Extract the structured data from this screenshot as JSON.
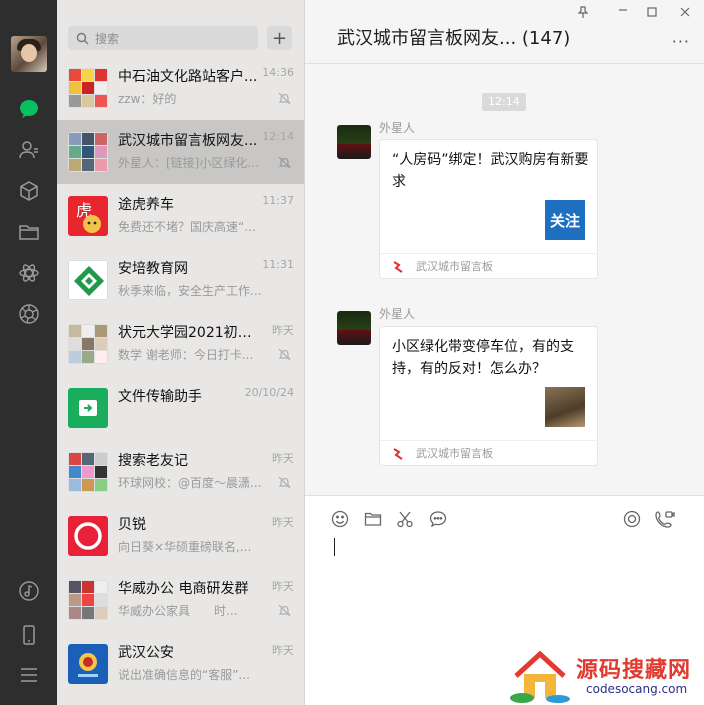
{
  "window": {
    "pin_icon": "pin-icon",
    "minimize_icon": "minimize-icon",
    "maximize_icon": "maximize-icon",
    "close_icon": "close-icon"
  },
  "sidebar": {
    "items": [
      {
        "name": "chat-icon",
        "active": true
      },
      {
        "name": "contacts-icon"
      },
      {
        "name": "collections-icon"
      },
      {
        "name": "files-icon"
      },
      {
        "name": "mini-programs-icon"
      },
      {
        "name": "moments-icon"
      },
      {
        "name": "music-icon"
      },
      {
        "name": "phone-icon"
      },
      {
        "name": "menu-icon"
      }
    ],
    "accent": "#07c160"
  },
  "search": {
    "placeholder": "搜索"
  },
  "chats": [
    {
      "name": "中石油文化路站客户...",
      "time": "14:36",
      "preview": "zzw：好的",
      "muted": true
    },
    {
      "name": "武汉城市留言板网友...",
      "time": "12:14",
      "preview": "外星人：[链接]小区绿化...",
      "muted": true,
      "active": true
    },
    {
      "name": "途虎养车",
      "time": "11:37",
      "preview": "免费还不堵？国庆高速“...",
      "muted": false
    },
    {
      "name": "安培教育网",
      "time": "11:31",
      "preview": "秋季来临，安全生产工作...",
      "muted": false
    },
    {
      "name": "状元大学园2021初一...",
      "time": "昨天",
      "preview": "数学 谢老师：今日打卡...",
      "muted": true
    },
    {
      "name": "文件传输助手",
      "time": "20/10/24",
      "preview": "",
      "muted": false
    },
    {
      "name": "搜索老友记",
      "time": "昨天",
      "preview": "环球网校：@百度～晨潇...",
      "muted": true
    },
    {
      "name": "贝锐",
      "time": "昨天",
      "preview": "向日葵×华硕重磅联名,...",
      "muted": false
    },
    {
      "name": "华威办公 电商研发群",
      "time": "昨天",
      "preview": "华威办公家具　　时...",
      "muted": true
    },
    {
      "name": "武汉公安",
      "time": "昨天",
      "preview": "说出准确信息的“客服”...",
      "muted": false
    }
  ],
  "conversation": {
    "title": "武汉城市留言板网友... (147)",
    "time_badge": "12:14",
    "messages": [
      {
        "sender": "外星人",
        "card_title": "“人房码”绑定！武汉购房有新要求",
        "thumb_text": "关注",
        "source": "武汉城市留言板"
      },
      {
        "sender": "外星人",
        "card_title": "小区绿化带变停车位，有的支持，有的反对！怎么办？",
        "thumb_text": "",
        "source": "武汉城市留言板"
      }
    ]
  },
  "composer": {
    "tools": [
      "emoji-icon",
      "folder-icon",
      "scissors-icon",
      "chat-history-icon",
      "live-icon",
      "video-call-icon"
    ]
  },
  "watermark": {
    "text": "源码搜藏网",
    "url": "codesocang.com"
  }
}
